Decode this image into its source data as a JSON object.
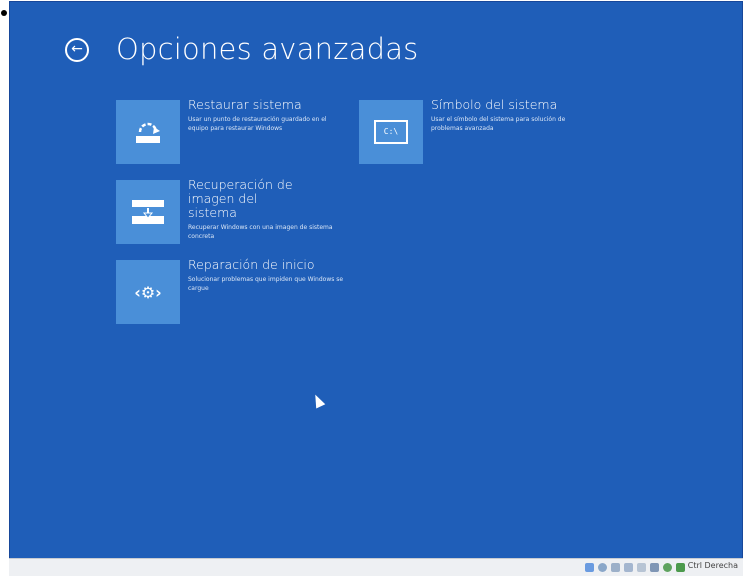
{
  "page": {
    "title": "Opciones avanzadas"
  },
  "tiles": [
    {
      "name": "Restaurar sistema",
      "description": "Usar un punto de restauración guardado en el equipo para restaurar Windows",
      "icon": "restore-icon"
    },
    {
      "name": "Símbolo del sistema",
      "description": "Usar el símbolo del sistema para solución de problemas avanzada",
      "icon": "command-prompt-icon",
      "icon_text": "C:\\"
    },
    {
      "name": "Recuperación de imagen del sistema",
      "description": "Recuperar Windows con una imagen de sistema concreta",
      "icon": "system-image-icon"
    },
    {
      "name": "Reparación de inicio",
      "description": "Solucionar problemas que impiden que Windows se cargue",
      "icon": "startup-repair-icon",
      "icon_text": "‹⚙›"
    }
  ],
  "statusbar": {
    "host_key": "Ctrl Derecha",
    "icons": [
      "hard-disk-icon",
      "optical-drive-icon",
      "usb-icon",
      "shared-folder-icon",
      "display-icon",
      "video-capture-icon",
      "network-icon",
      "mouse-integration-icon"
    ]
  },
  "colors": {
    "background": "#1f5eb8",
    "tile": "#4a8fd8",
    "text": "#ffffff"
  }
}
